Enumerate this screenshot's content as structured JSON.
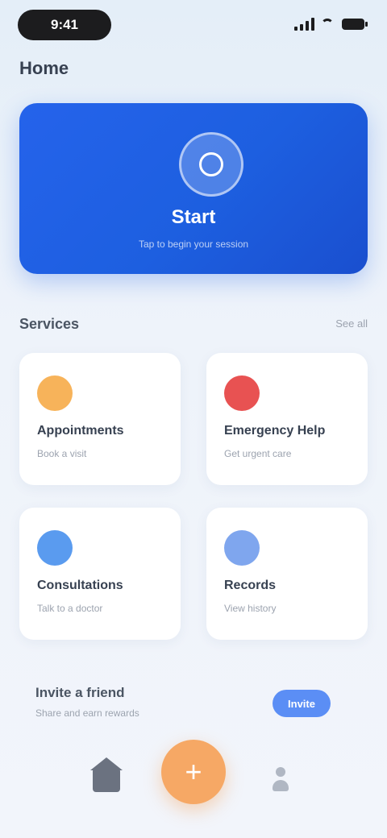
{
  "status_bar": {
    "time": "9:41"
  },
  "header": {
    "title": "Home"
  },
  "hero": {
    "label": "Start",
    "sub": "Tap to begin your session"
  },
  "section": {
    "title": "Services",
    "link": "See all"
  },
  "tiles": [
    {
      "title": "Appointments",
      "sub": "Book a visit",
      "color": "#f7b35a"
    },
    {
      "title": "Emergency Help",
      "sub": "Get urgent care",
      "color": "#e85252"
    },
    {
      "title": "Consultations",
      "sub": "Talk to a doctor",
      "color": "#5a9bef"
    },
    {
      "title": "Records",
      "sub": "View history",
      "color": "#7fa6ee"
    }
  ],
  "promo": {
    "text": "Invite a friend",
    "sub": "Share and earn rewards",
    "button": "Invite"
  },
  "nav": {
    "fab_icon": "+"
  },
  "colors": {
    "accent": "#2563eb",
    "fab": "#f6a865"
  }
}
